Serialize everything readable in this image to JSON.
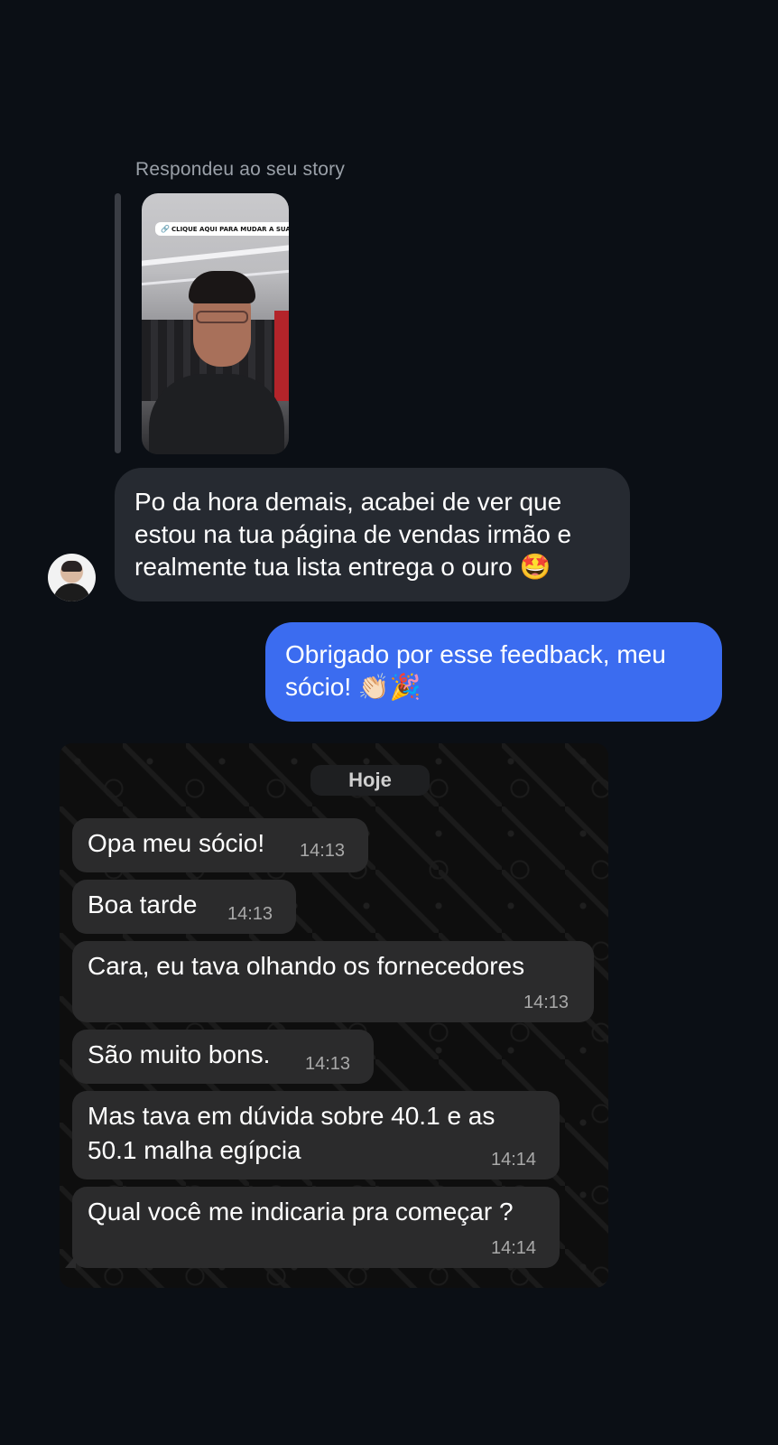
{
  "reply_header": "Respondeu ao seu story",
  "story": {
    "sticker_text": "CLIQUE AQUI PARA MUDAR A SUA VIDA!",
    "sticker_icon": "link-icon"
  },
  "incoming_message": {
    "line1": "Po da hora demais, acabei de ver que",
    "line2": "estou na tua página de vendas irmão e",
    "line3": "realmente tua lista entrega o ouro 🤩"
  },
  "outgoing_message": {
    "line1": "Obrigado por esse feedback, meu",
    "line2": "sócio! 👏🏻🎉"
  },
  "whatsapp_screenshot": {
    "date_label": "Hoje",
    "messages": [
      {
        "text": "Opa meu sócio!",
        "time": "14:13"
      },
      {
        "text": "Boa tarde",
        "time": "14:13"
      },
      {
        "text": "Cara, eu tava olhando os fornecedores",
        "time": "14:13"
      },
      {
        "text": "São muito bons.",
        "time": "14:13"
      },
      {
        "text_line1": "Mas tava em dúvida sobre 40.1 e as",
        "text_line2": "50.1 malha egípcia",
        "time": "14:14"
      },
      {
        "text": "Qual você me indicaria pra começar ?",
        "time": "14:14"
      }
    ]
  }
}
